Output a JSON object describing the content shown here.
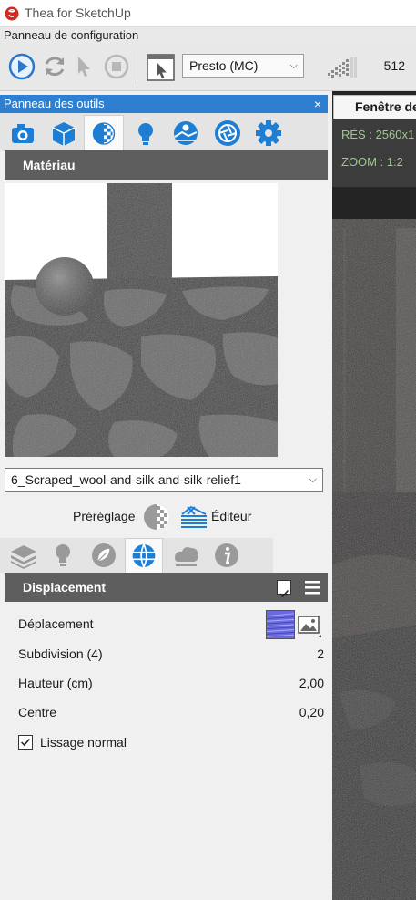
{
  "app": {
    "title": "Thea for SketchUp"
  },
  "config_bar": {
    "label": "Panneau de configuration"
  },
  "toolbar": {
    "engine": "Presto (MC)",
    "count": "512"
  },
  "tools_panel": {
    "title": "Panneau des outils",
    "close": "×"
  },
  "material": {
    "section_title": "Matériau",
    "name": "6_Scraped_wool-and-silk-and-silk-relief1",
    "preset_label": "Préréglage",
    "editor_label": "Éditeur"
  },
  "displacement": {
    "section_title": "Displacement",
    "rows": [
      {
        "label": "Déplacement",
        "value": ""
      },
      {
        "label": "Subdivision (4)",
        "value": "2"
      },
      {
        "label": "Hauteur (cm)",
        "value": "2,00"
      },
      {
        "label": "Centre",
        "value": "0,20"
      }
    ],
    "normal_smoothing": "Lissage normal"
  },
  "render_window": {
    "tab": "Fenêtre de",
    "resolution": "RÉS : 2560x1",
    "zoom": "ZOOM : 1:2"
  },
  "colors": {
    "accent": "#2f7fd1",
    "section_header": "#5e5e5e",
    "info_text": "#9ec98c"
  }
}
